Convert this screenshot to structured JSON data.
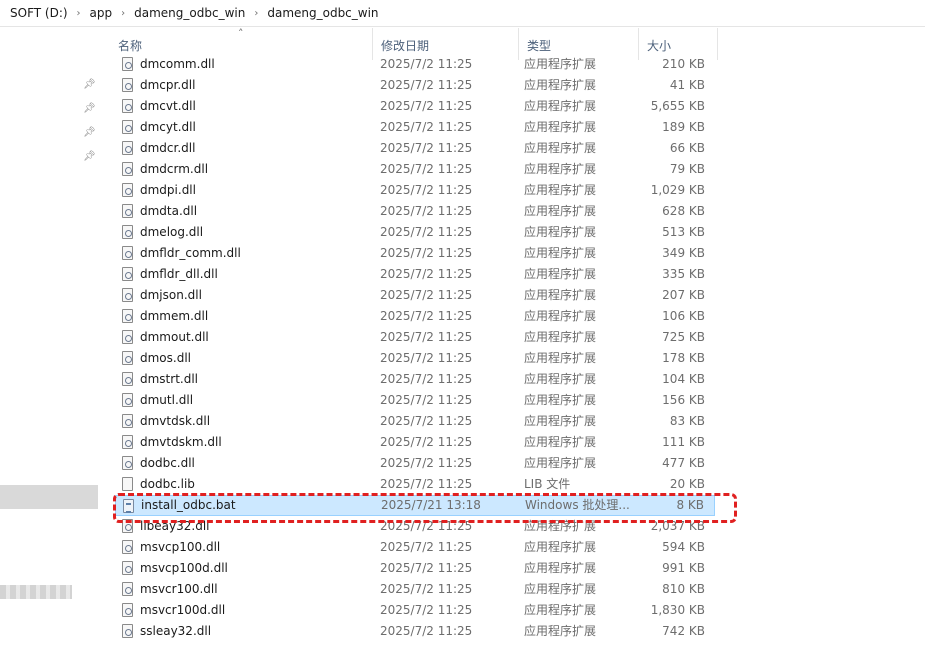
{
  "address": {
    "crumbs": [
      "SOFT (D:)",
      "app",
      "dameng_odbc_win",
      "dameng_odbc_win"
    ]
  },
  "columns": {
    "name": "名称",
    "date": "修改日期",
    "type": "类型",
    "size": "大小"
  },
  "rows": [
    {
      "name": "dmcomm.dll",
      "date": "2025/7/2 11:25",
      "type": "应用程序扩展",
      "size": "210 KB",
      "icon": "dll-icon"
    },
    {
      "name": "dmcpr.dll",
      "date": "2025/7/2 11:25",
      "type": "应用程序扩展",
      "size": "41 KB",
      "icon": "dll-icon"
    },
    {
      "name": "dmcvt.dll",
      "date": "2025/7/2 11:25",
      "type": "应用程序扩展",
      "size": "5,655 KB",
      "icon": "dll-icon"
    },
    {
      "name": "dmcyt.dll",
      "date": "2025/7/2 11:25",
      "type": "应用程序扩展",
      "size": "189 KB",
      "icon": "dll-icon"
    },
    {
      "name": "dmdcr.dll",
      "date": "2025/7/2 11:25",
      "type": "应用程序扩展",
      "size": "66 KB",
      "icon": "dll-icon"
    },
    {
      "name": "dmdcrm.dll",
      "date": "2025/7/2 11:25",
      "type": "应用程序扩展",
      "size": "79 KB",
      "icon": "dll-icon"
    },
    {
      "name": "dmdpi.dll",
      "date": "2025/7/2 11:25",
      "type": "应用程序扩展",
      "size": "1,029 KB",
      "icon": "dll-icon"
    },
    {
      "name": "dmdta.dll",
      "date": "2025/7/2 11:25",
      "type": "应用程序扩展",
      "size": "628 KB",
      "icon": "dll-icon"
    },
    {
      "name": "dmelog.dll",
      "date": "2025/7/2 11:25",
      "type": "应用程序扩展",
      "size": "513 KB",
      "icon": "dll-icon"
    },
    {
      "name": "dmfldr_comm.dll",
      "date": "2025/7/2 11:25",
      "type": "应用程序扩展",
      "size": "349 KB",
      "icon": "dll-icon"
    },
    {
      "name": "dmfldr_dll.dll",
      "date": "2025/7/2 11:25",
      "type": "应用程序扩展",
      "size": "335 KB",
      "icon": "dll-icon"
    },
    {
      "name": "dmjson.dll",
      "date": "2025/7/2 11:25",
      "type": "应用程序扩展",
      "size": "207 KB",
      "icon": "dll-icon"
    },
    {
      "name": "dmmem.dll",
      "date": "2025/7/2 11:25",
      "type": "应用程序扩展",
      "size": "106 KB",
      "icon": "dll-icon"
    },
    {
      "name": "dmmout.dll",
      "date": "2025/7/2 11:25",
      "type": "应用程序扩展",
      "size": "725 KB",
      "icon": "dll-icon"
    },
    {
      "name": "dmos.dll",
      "date": "2025/7/2 11:25",
      "type": "应用程序扩展",
      "size": "178 KB",
      "icon": "dll-icon"
    },
    {
      "name": "dmstrt.dll",
      "date": "2025/7/2 11:25",
      "type": "应用程序扩展",
      "size": "104 KB",
      "icon": "dll-icon"
    },
    {
      "name": "dmutl.dll",
      "date": "2025/7/2 11:25",
      "type": "应用程序扩展",
      "size": "156 KB",
      "icon": "dll-icon"
    },
    {
      "name": "dmvtdsk.dll",
      "date": "2025/7/2 11:25",
      "type": "应用程序扩展",
      "size": "83 KB",
      "icon": "dll-icon"
    },
    {
      "name": "dmvtdskm.dll",
      "date": "2025/7/2 11:25",
      "type": "应用程序扩展",
      "size": "111 KB",
      "icon": "dll-icon"
    },
    {
      "name": "dodbc.dll",
      "date": "2025/7/2 11:25",
      "type": "应用程序扩展",
      "size": "477 KB",
      "icon": "dll-icon"
    },
    {
      "name": "dodbc.lib",
      "date": "2025/7/2 11:25",
      "type": "LIB 文件",
      "size": "20 KB",
      "icon": "lib-file-icon"
    },
    {
      "name": "install_odbc.bat",
      "date": "2025/7/21 13:18",
      "type": "Windows 批处理...",
      "size": "8 KB",
      "icon": "batch-file-icon",
      "selected": true
    },
    {
      "name": "libeay32.dll",
      "date": "2025/7/2 11:25",
      "type": "应用程序扩展",
      "size": "2,037 KB",
      "icon": "dll-icon"
    },
    {
      "name": "msvcp100.dll",
      "date": "2025/7/2 11:25",
      "type": "应用程序扩展",
      "size": "594 KB",
      "icon": "dll-icon"
    },
    {
      "name": "msvcp100d.dll",
      "date": "2025/7/2 11:25",
      "type": "应用程序扩展",
      "size": "991 KB",
      "icon": "dll-icon"
    },
    {
      "name": "msvcr100.dll",
      "date": "2025/7/2 11:25",
      "type": "应用程序扩展",
      "size": "810 KB",
      "icon": "dll-icon"
    },
    {
      "name": "msvcr100d.dll",
      "date": "2025/7/2 11:25",
      "type": "应用程序扩展",
      "size": "1,830 KB",
      "icon": "dll-icon"
    },
    {
      "name": "ssleay32.dll",
      "date": "2025/7/2 11:25",
      "type": "应用程序扩展",
      "size": "742 KB",
      "icon": "dll-icon"
    }
  ],
  "colors": {
    "selection": "#cce8ff",
    "selection_border": "#99d1ff",
    "annotation": "#e02020",
    "header_text": "#4c607a"
  }
}
